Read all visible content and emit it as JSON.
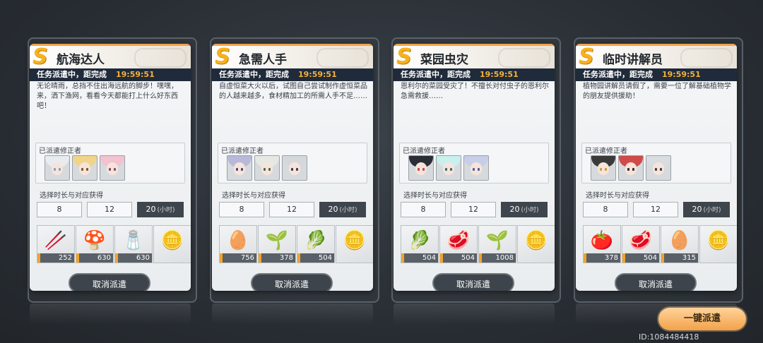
{
  "status_label": "任务派遣中，距完成",
  "dispatched_label": "已派遣修正者",
  "duration_label": "选择时长与对应获得",
  "durations": [
    "8",
    "12",
    "20"
  ],
  "duration_unit": "(小时)",
  "cancel_label": "取消派遣",
  "one_click_label": "一键派遣",
  "id_text": "ID:1084484418",
  "cards": [
    {
      "title": "航海达人",
      "time": "19:59:51",
      "desc": "无论晴雨，总挡不住出海远航的脚步！嘿嘿，来，洒下渔网，看看今天都能打上什么好东西吧！",
      "items": [
        {
          "icon": "cinnamon-sticks-icon",
          "glyph": "🥢",
          "qty": "252"
        },
        {
          "icon": "mushroom-icon",
          "glyph": "🍄",
          "qty": "630"
        },
        {
          "icon": "salt-icon",
          "glyph": "🧂",
          "qty": "630"
        },
        {
          "icon": "coin-plate-icon",
          "glyph": "🪙",
          "qty": ""
        }
      ]
    },
    {
      "title": "急需人手",
      "time": "19:59:51",
      "desc": "自虚恒菜大火以后，试图自己尝试制作虚恒菜品的人越来越多，食材精加工的所需人手不足……",
      "items": [
        {
          "icon": "egg-icon",
          "glyph": "🥚",
          "qty": "756"
        },
        {
          "icon": "scallion-icon",
          "glyph": "🌱",
          "qty": "378"
        },
        {
          "icon": "bok-choy-icon",
          "glyph": "🥬",
          "qty": "504"
        },
        {
          "icon": "coin-plate-icon",
          "glyph": "🪙",
          "qty": ""
        }
      ]
    },
    {
      "title": "菜园虫灾",
      "time": "19:59:51",
      "desc": "恩利尔的菜园受灾了！不擅长对付虫子的恩利尔急需救援……",
      "items": [
        {
          "icon": "bok-choy-icon",
          "glyph": "🥬",
          "qty": "504"
        },
        {
          "icon": "steak-icon",
          "glyph": "🥩",
          "qty": "504"
        },
        {
          "icon": "scallion-icon",
          "glyph": "🌱",
          "qty": "1008"
        },
        {
          "icon": "coin-plate-icon",
          "glyph": "🪙",
          "qty": ""
        }
      ]
    },
    {
      "title": "临时讲解员",
      "time": "19:59:51",
      "desc": "植物园讲解员请假了，需要一位了解基础植物学的朋友提供援助！",
      "items": [
        {
          "icon": "tomato-icon",
          "glyph": "🍅",
          "qty": "378"
        },
        {
          "icon": "steak-icon",
          "glyph": "🥩",
          "qty": "504"
        },
        {
          "icon": "egg-icon",
          "glyph": "🥚",
          "qty": "315"
        },
        {
          "icon": "coin-plate-icon",
          "glyph": "🪙",
          "qty": ""
        }
      ]
    }
  ]
}
